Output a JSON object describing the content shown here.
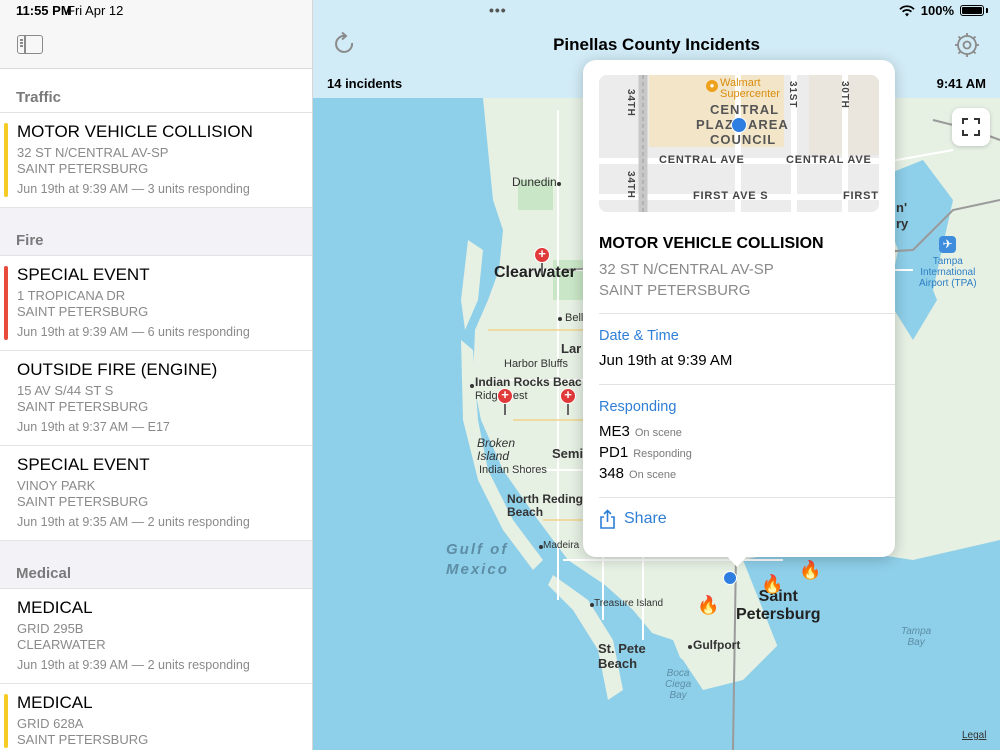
{
  "status_bar": {
    "time": "11:55 PM",
    "date": "Fri Apr 12",
    "battery": "100%"
  },
  "nav": {
    "title": "Pinellas County Incidents",
    "incident_count": "14 incidents",
    "updated_time": "9:41 AM"
  },
  "sidebar": {
    "sections": [
      {
        "header": "Traffic",
        "items": [
          {
            "title": "MOTOR VEHICLE COLLISION",
            "address": "32 ST N/CENTRAL AV-SP",
            "city": "SAINT PETERSBURG",
            "meta": "Jun 19th at 9:39 AM — 3 units responding",
            "accent": "#f4cc24"
          }
        ]
      },
      {
        "header": "Fire",
        "items": [
          {
            "title": "SPECIAL EVENT",
            "address": "1 TROPICANA DR",
            "city": "SAINT PETERSBURG",
            "meta": "Jun 19th at 9:39 AM — 6 units responding",
            "accent": "#e84b3c"
          },
          {
            "title": "OUTSIDE FIRE (ENGINE)",
            "address": "15 AV S/44 ST S",
            "city": "SAINT PETERSBURG",
            "meta": "Jun 19th at 9:37 AM — E17",
            "accent": ""
          },
          {
            "title": "SPECIAL EVENT",
            "address": "VINOY PARK",
            "city": "SAINT PETERSBURG",
            "meta": "Jun 19th at 9:35 AM — 2 units responding",
            "accent": ""
          }
        ]
      },
      {
        "header": "Medical",
        "items": [
          {
            "title": "MEDICAL",
            "address": "GRID 295B",
            "city": "CLEARWATER",
            "meta": "Jun 19th at 9:39 AM — 2 units responding",
            "accent": ""
          },
          {
            "title": "MEDICAL",
            "address": "GRID 628A",
            "city": "SAINT PETERSBURG",
            "meta": "",
            "accent": "#f4cc24"
          }
        ]
      }
    ]
  },
  "map": {
    "labels": {
      "dunedin": "Dunedin",
      "clearwater": "Clearwater",
      "belleair": "Belleair",
      "largo": "Lar",
      "harbor_bluffs": "Harbor Bluffs",
      "indian_rocks": "Indian Rocks Beac",
      "ridgecrest": "Ridg     est",
      "seminole": "Semi",
      "broken_island": "Broken\nIsland",
      "indian_shores": "Indian Shores",
      "north_redington": "North Reding\nBeach",
      "madeira": "Madeira",
      "gulf": "Gulf of\nMexico",
      "treasure_island": "Treasure Island",
      "saint_petersburg": "Saint\nPetersburg",
      "st_pete_beach": "St. Pete\nBeach",
      "gulfport": "Gulfport",
      "boca_ciega": "Boca\nCiega\nBay",
      "tampa_bay": "Tampa\nBay",
      "tampa_airport": "Tampa\nInternational\nAirport (TPA)",
      "partial_n": "n'",
      "partial_ry": "ry",
      "legal": "Legal"
    }
  },
  "popover": {
    "mini_map": {
      "store": "Walmart\nSupercenter",
      "council1": "CENTRAL",
      "council2": "PLAZA AREA",
      "council3": "COUNCIL",
      "central_ave_left": "CENTRAL AVE",
      "central_ave_right": "CENTRAL AVE",
      "first_ave": "FIRST AVE S",
      "first_ave_right": "FIRST",
      "st_34_top": "34TH",
      "st_34_bottom": "34TH",
      "st_31": "31ST",
      "st_30": "30TH"
    },
    "title": "MOTOR VEHICLE COLLISION",
    "address1": "32 ST N/CENTRAL AV-SP",
    "address2": "SAINT PETERSBURG",
    "date_label": "Date & Time",
    "date_value": "Jun 19th at 9:39 AM",
    "responding_label": "Responding",
    "units": [
      {
        "id": "ME3",
        "status": "On scene"
      },
      {
        "id": "PD1",
        "status": "Responding"
      },
      {
        "id": "348",
        "status": "On scene"
      }
    ],
    "share_label": "Share"
  },
  "colors": {
    "accent_blue": "#2f7fd6",
    "water": "#8ecfe9",
    "land": "#e6f0e3",
    "traffic_yellow": "#f4cc24",
    "fire_red": "#e84b3c"
  }
}
